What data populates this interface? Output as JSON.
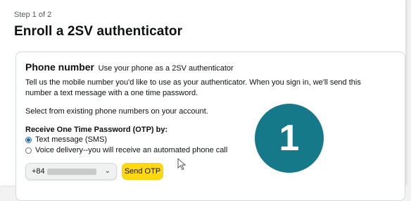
{
  "header": {
    "step": "Step 1 of 2",
    "title": "Enroll a 2SV authenticator"
  },
  "card": {
    "heading": "Phone number",
    "heading_sub": "Use your phone as a 2SV authenticator",
    "description": "Tell us the mobile number you'd like to use as your authenticator. When you sign in, we'll send this number a text message with a one time password.",
    "select_existing": "Select from existing phone numbers on your account.",
    "otp_label": "Receive One Time Password (OTP) by:",
    "options": [
      {
        "label": "Text message (SMS)",
        "selected": true
      },
      {
        "label": "Voice delivery--you will receive an automated phone call",
        "selected": false
      }
    ],
    "country_code": "+84",
    "send_button": "Send OTP"
  },
  "badge": {
    "number": "1"
  },
  "colors": {
    "badge": "#16798a",
    "button": "#ffd814",
    "radio_selected": "#2162a1"
  }
}
